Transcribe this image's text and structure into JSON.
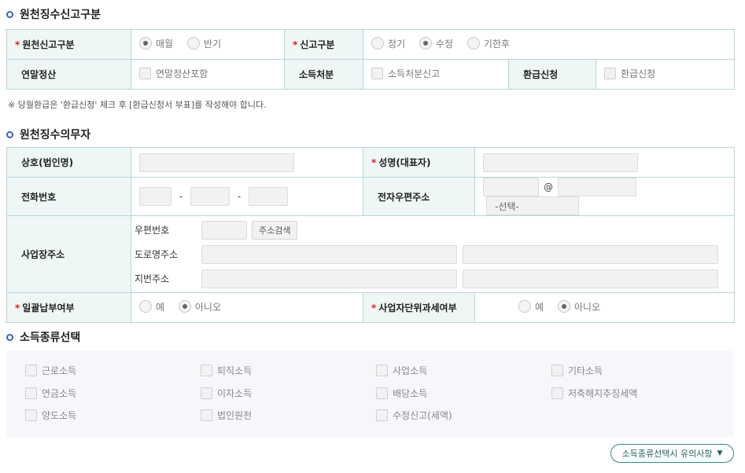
{
  "section1": {
    "title": "원천징수신고구분",
    "report_type_label": "원천신고구분",
    "report_type_options": [
      "매월",
      "반기"
    ],
    "report_type_selected": "매월",
    "filing_type_label": "신고구분",
    "filing_type_options": [
      "정기",
      "수정",
      "기한후"
    ],
    "filing_type_selected": "수정",
    "year_end_label": "연말정산",
    "year_end_checkbox": "연말정산포함",
    "income_disposal_label": "소득처분",
    "income_disposal_checkbox": "소득처분신고",
    "refund_label": "환급신청",
    "refund_checkbox": "환급신청",
    "note": "※ 당월환급은 '환급신청' 체크 후 [환급신청서 부표]를 작성해야 합니다."
  },
  "section2": {
    "title": "원천징수의무자",
    "company_label": "상호(법인명)",
    "rep_label": "성명(대표자)",
    "phone_label": "전화번호",
    "phone_sep": "-",
    "email_label": "전자우편주소",
    "email_at": "@",
    "email_select": "-선택-",
    "address_label": "사업장주소",
    "zip_label": "우편번호",
    "zip_search_button": "주소검색",
    "road_label": "도로명주소",
    "lot_label": "지번주소",
    "lump_label": "일괄납부여부",
    "lump_options": [
      "예",
      "아니오"
    ],
    "lump_selected": "아니오",
    "unit_label": "사업자단위과세여부",
    "unit_options": [
      "예",
      "아니오"
    ],
    "unit_selected": "아니오"
  },
  "section3": {
    "title": "소득종류선택",
    "items": [
      "근로소득",
      "퇴직소득",
      "사업소득",
      "기타소득",
      "연금소득",
      "이자소득",
      "배당소득",
      "저축해지추징세액",
      "양도소득",
      "법인원천",
      "수정신고(세액)"
    ],
    "notice_button": "소득종류선택시 유의사항"
  },
  "colors": {
    "header_bg": "#eef6f6",
    "border": "#b9d6d9",
    "required": "#dd2222",
    "section_dot": "#3a63c9",
    "button_border": "#2a8a8a"
  }
}
